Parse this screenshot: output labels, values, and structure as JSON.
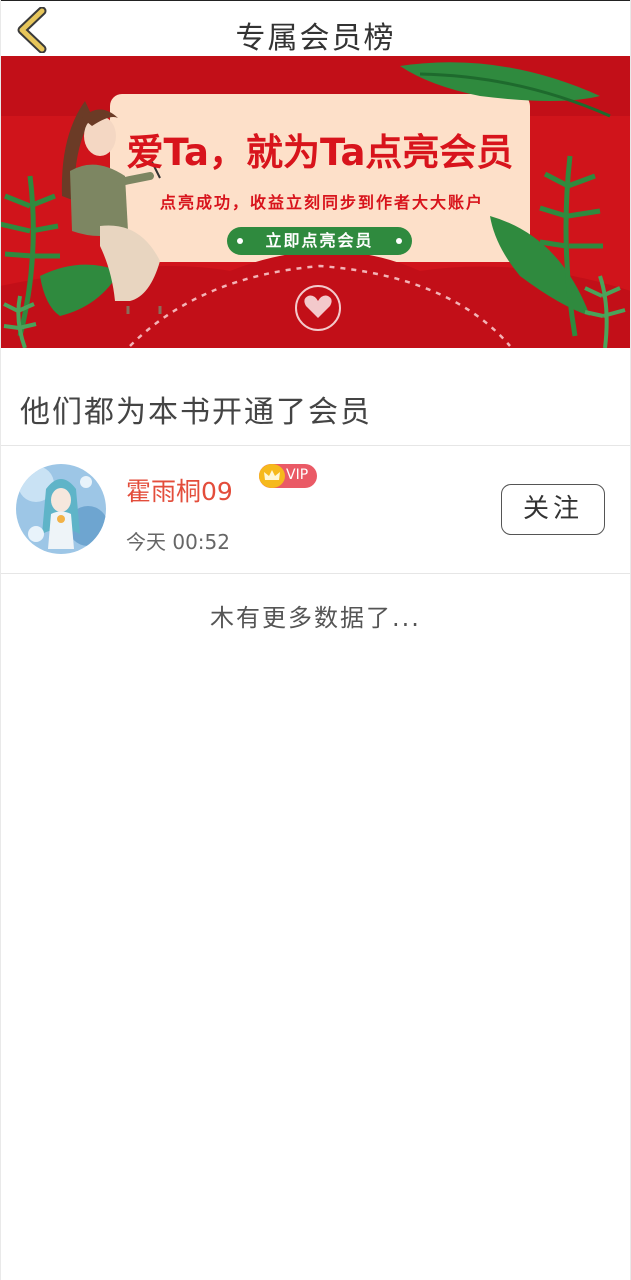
{
  "header": {
    "title": "专属会员榜",
    "back_icon": "chevron-left-icon",
    "back_icon_color": "#e7c65b"
  },
  "banner": {
    "headline": "爱Ta，就为Ta点亮会员",
    "subtitle": "点亮成功，收益立刻同步到作者大大账户",
    "cta_label": "立即点亮会员",
    "colors": {
      "background": "#d0141b",
      "card": "#fde0c9",
      "text": "#d8141c",
      "cta": "#2f8a3e"
    }
  },
  "section": {
    "title": "他们都为本书开通了会员"
  },
  "members": [
    {
      "name": "霍雨桐09",
      "badge": "VIP",
      "time": "今天 00:52",
      "follow_label": "关注"
    }
  ],
  "footer": {
    "no_more_text": "木有更多数据了..."
  }
}
